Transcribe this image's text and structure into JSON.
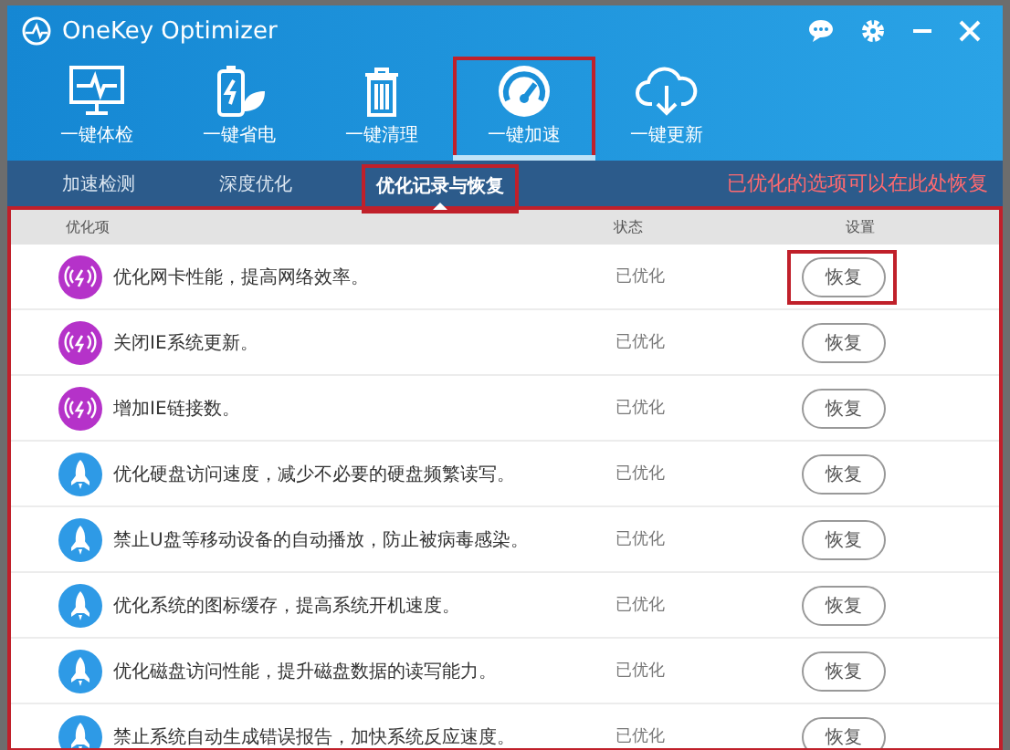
{
  "window": {
    "title": "OneKey Optimizer"
  },
  "toolbar": [
    {
      "kind": "checkup",
      "label": "一键体检",
      "selected": false,
      "annotated": false
    },
    {
      "kind": "power",
      "label": "一键省电",
      "selected": false,
      "annotated": false
    },
    {
      "kind": "clean",
      "label": "一键清理",
      "selected": false,
      "annotated": false
    },
    {
      "kind": "speed",
      "label": "一键加速",
      "selected": true,
      "annotated": true
    },
    {
      "kind": "update",
      "label": "一键更新",
      "selected": false,
      "annotated": false
    }
  ],
  "tabs": [
    {
      "label": "加速检测",
      "selected": false,
      "annotated": false
    },
    {
      "label": "深度优化",
      "selected": false,
      "annotated": false
    },
    {
      "label": "优化记录与恢复",
      "selected": true,
      "annotated": true
    }
  ],
  "annotation": "已优化的选项可以在此处恢复",
  "table": {
    "annotated": true,
    "columns": [
      "优化项",
      "状态",
      "设置"
    ],
    "rows": [
      {
        "kind": "network",
        "item": "优化网卡性能，提高网络效率。",
        "status": "已优化",
        "button": "恢复",
        "annotated": true
      },
      {
        "kind": "network",
        "item": "关闭IE系统更新。",
        "status": "已优化",
        "button": "恢复",
        "annotated": false
      },
      {
        "kind": "network",
        "item": "增加IE链接数。",
        "status": "已优化",
        "button": "恢复",
        "annotated": false
      },
      {
        "kind": "rocket",
        "item": "优化硬盘访问速度，减少不必要的硬盘频繁读写。",
        "status": "已优化",
        "button": "恢复",
        "annotated": false
      },
      {
        "kind": "rocket",
        "item": "禁止U盘等移动设备的自动播放，防止被病毒感染。",
        "status": "已优化",
        "button": "恢复",
        "annotated": false
      },
      {
        "kind": "rocket",
        "item": "优化系统的图标缓存，提高系统开机速度。",
        "status": "已优化",
        "button": "恢复",
        "annotated": false
      },
      {
        "kind": "rocket",
        "item": "优化磁盘访问性能，提升磁盘数据的读写能力。",
        "status": "已优化",
        "button": "恢复",
        "annotated": false
      },
      {
        "kind": "rocket",
        "item": "禁止系统自动生成错误报告，加快系统反应速度。",
        "status": "已优化",
        "button": "恢复",
        "annotated": false
      }
    ]
  }
}
